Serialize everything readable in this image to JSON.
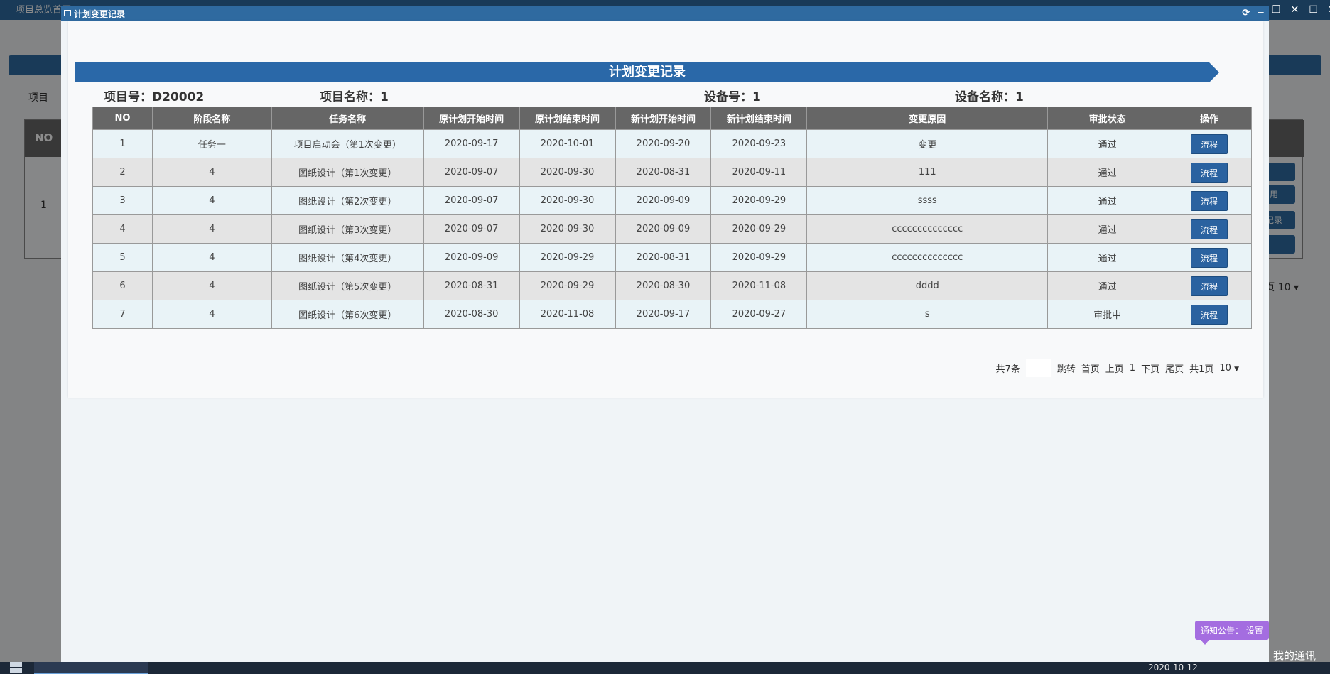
{
  "background": {
    "tab_label": "项目总览首页",
    "label": "项目",
    "table_no_header": "NO",
    "table_first_no": "1",
    "right_buttons": [
      "",
      "",
      "用",
      "记录",
      ""
    ],
    "pager_text": "页 10 ▾"
  },
  "modal": {
    "title": "计划变更记录",
    "banner": "计划变更记录",
    "info": {
      "project_no": "项目号：D20002",
      "project_name": "项目名称：1",
      "device_no": "设备号：1",
      "device_name": "设备名称：1"
    },
    "columns": [
      "NO",
      "阶段名称",
      "任务名称",
      "原计划开始时间",
      "原计划结束时间",
      "新计划开始时间",
      "新计划结束时间",
      "变更原因",
      "审批状态",
      "操作"
    ],
    "rows": [
      {
        "no": "1",
        "stage": "任务一",
        "task": "项目启动会（第1次变更）",
        "orig_start": "2020-09-17",
        "orig_end": "2020-10-01",
        "new_start": "2020-09-20",
        "new_end": "2020-09-23",
        "reason": "变更",
        "status": "通过",
        "action": "流程"
      },
      {
        "no": "2",
        "stage": "4",
        "task": "图纸设计（第1次变更）",
        "orig_start": "2020-09-07",
        "orig_end": "2020-09-30",
        "new_start": "2020-08-31",
        "new_end": "2020-09-11",
        "reason": "111",
        "status": "通过",
        "action": "流程"
      },
      {
        "no": "3",
        "stage": "4",
        "task": "图纸设计（第2次变更）",
        "orig_start": "2020-09-07",
        "orig_end": "2020-09-30",
        "new_start": "2020-09-09",
        "new_end": "2020-09-29",
        "reason": "ssss",
        "status": "通过",
        "action": "流程"
      },
      {
        "no": "4",
        "stage": "4",
        "task": "图纸设计（第3次变更）",
        "orig_start": "2020-09-07",
        "orig_end": "2020-09-30",
        "new_start": "2020-09-09",
        "new_end": "2020-09-29",
        "reason": "cccccccccccccc",
        "status": "通过",
        "action": "流程"
      },
      {
        "no": "5",
        "stage": "4",
        "task": "图纸设计（第4次变更）",
        "orig_start": "2020-09-09",
        "orig_end": "2020-09-29",
        "new_start": "2020-08-31",
        "new_end": "2020-09-29",
        "reason": "cccccccccccccc",
        "status": "通过",
        "action": "流程"
      },
      {
        "no": "6",
        "stage": "4",
        "task": "图纸设计（第5次变更）",
        "orig_start": "2020-08-31",
        "orig_end": "2020-09-29",
        "new_start": "2020-08-30",
        "new_end": "2020-11-08",
        "reason": "dddd",
        "status": "通过",
        "action": "流程"
      },
      {
        "no": "7",
        "stage": "4",
        "task": "图纸设计（第6次变更）",
        "orig_start": "2020-08-30",
        "orig_end": "2020-11-08",
        "new_start": "2020-09-17",
        "new_end": "2020-09-27",
        "reason": "s",
        "status": "审批中",
        "action": "流程"
      }
    ],
    "pager": {
      "total": "共7条",
      "jump_value": "",
      "jump": "跳转",
      "first": "首页",
      "prev": "上页",
      "current": "1",
      "next": "下页",
      "last": "尾页",
      "pages": "共1页",
      "page_size": "10"
    }
  },
  "notice": "通知公告： 设置",
  "taskbar": {
    "date": "2020-10-12",
    "mine": "我的通讯"
  },
  "colors": {
    "accent": "#2f6aa0",
    "header_gray": "#666666",
    "notice_purple": "#a46de0"
  }
}
